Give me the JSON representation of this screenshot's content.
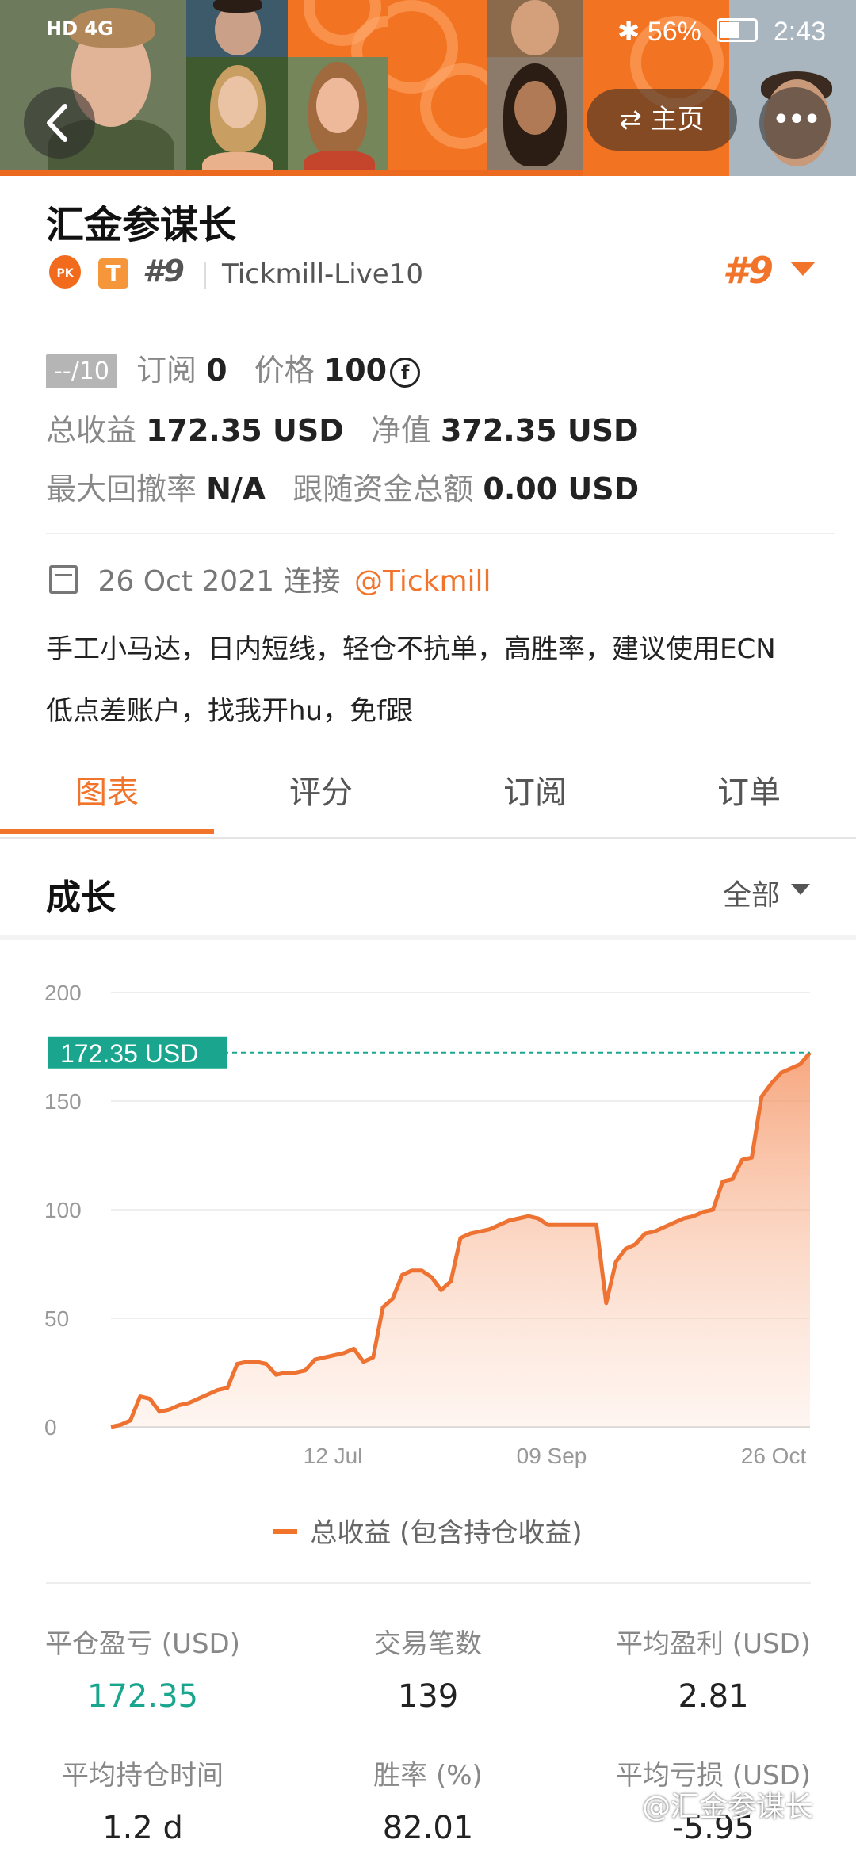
{
  "status_bar": {
    "left": "HD 4G",
    "battery": "56%",
    "time": "2:43"
  },
  "header": {
    "home_label": "⇄ 主页",
    "more_label": "•••"
  },
  "profile": {
    "name": "汇金参谋长",
    "pk_badge": "PK",
    "t_badge": "T",
    "rank_small": "#9",
    "server": "Tickmill-Live10",
    "rank_big": "#9",
    "score": "--/10",
    "subscribe_label": "订阅",
    "subscribe_value": "0",
    "price_label": "价格",
    "price_value": "100",
    "coin_symbol": "f",
    "total_profit_label": "总收益",
    "total_profit_value": "172.35 USD",
    "equity_label": "净值",
    "equity_value": "372.35 USD",
    "drawdown_label": "最大回撤率",
    "drawdown_value": "N/A",
    "follow_label": "跟随资金总额",
    "follow_value": "0.00 USD",
    "connect_date": "26 Oct 2021",
    "connect_label": "连接",
    "broker_link": "@Tickmill",
    "description_line1": "手工小马达，日内短线，轻仓不抗单，高胜率，建议使用ECN",
    "description_line2": "低点差账户，找我开hu，免f跟"
  },
  "tabs": [
    "图表",
    "评分",
    "订阅",
    "订单"
  ],
  "section": {
    "title": "成长",
    "filter": "全部"
  },
  "chart_data": {
    "type": "area",
    "current_label": "172.35 USD",
    "current_value": 172.35,
    "ylim": [
      0,
      200
    ],
    "y_ticks": [
      0,
      50,
      100,
      150,
      200
    ],
    "x_tick_labels": [
      "12 Jul",
      "09 Sep",
      "26 Oct"
    ],
    "legend": "总收益 (包含持仓收益)",
    "series": [
      {
        "name": "总收益 (包含持仓收益)",
        "values": [
          0,
          1,
          3,
          14,
          13,
          7,
          8,
          10,
          11,
          13,
          15,
          17,
          18,
          29,
          30,
          30,
          29,
          24,
          25,
          25,
          26,
          31,
          32,
          33,
          34,
          36,
          30,
          32,
          55,
          59,
          70,
          72,
          72,
          69,
          63,
          67,
          87,
          89,
          90,
          91,
          93,
          95,
          96,
          97,
          96,
          93,
          93,
          93,
          93,
          93,
          93,
          57,
          76,
          82,
          84,
          89,
          90,
          92,
          94,
          96,
          97,
          99,
          100,
          113,
          114,
          123,
          124,
          152,
          158,
          163,
          165,
          167,
          172.35
        ]
      }
    ]
  },
  "stats": [
    {
      "label": "平仓盈亏 (USD)",
      "value": "172.35",
      "highlight": true
    },
    {
      "label": "交易笔数",
      "value": "139",
      "highlight": false
    },
    {
      "label": "平均盈利 (USD)",
      "value": "2.81",
      "highlight": false
    },
    {
      "label": "平均持仓时间",
      "value": "1.2 d",
      "highlight": false
    },
    {
      "label": "胜率 (%)",
      "value": "82.01",
      "highlight": false
    },
    {
      "label": "平均亏损 (USD)",
      "value": "-5.95",
      "highlight": false
    }
  ],
  "watermark": "@汇金参谋长",
  "colors": {
    "accent": "#f2742a",
    "green": "#1aa68e"
  }
}
